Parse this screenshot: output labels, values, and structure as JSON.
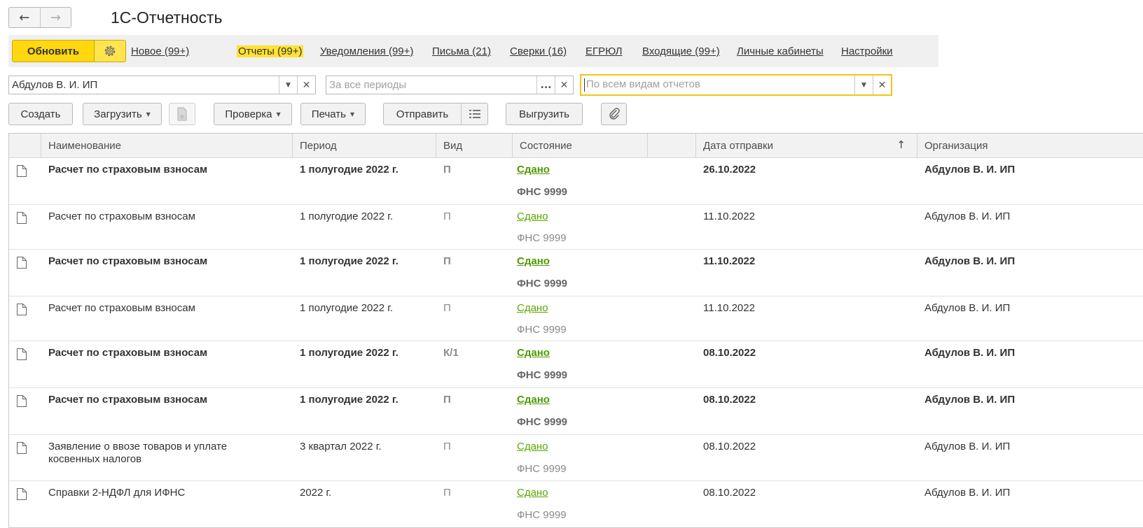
{
  "window": {
    "title": "1С-Отчетность",
    "back_icon": "arrow-left-icon",
    "forward_icon": "arrow-right-icon"
  },
  "linkbar": {
    "refresh_label": "Обновить",
    "settings_icon": "gear-icon",
    "links": [
      {
        "label": "Новое (99+)",
        "active": false
      },
      {
        "label": "Отчеты (99+)",
        "active": true
      },
      {
        "label": "Уведомления (99+)",
        "active": false
      },
      {
        "label": "Письма (21)",
        "active": false
      },
      {
        "label": "Сверки (16)",
        "active": false
      },
      {
        "label": "ЕГРЮЛ",
        "active": false
      },
      {
        "label": "Входящие (99+)",
        "active": false
      },
      {
        "label": "Личные кабинеты",
        "active": false
      },
      {
        "label": "Настройки",
        "active": false
      }
    ]
  },
  "filters": {
    "organization": {
      "value": "Абдулов В. И. ИП"
    },
    "period": {
      "placeholder": "За все периоды",
      "select_label": "..."
    },
    "report_kind": {
      "placeholder": "По всем видам отчетов"
    }
  },
  "toolbar": {
    "create": "Создать",
    "load": "Загрузить",
    "check": "Проверка",
    "print": "Печать",
    "send": "Отправить",
    "export": "Выгрузить"
  },
  "table": {
    "columns": [
      "Наименование",
      "Период",
      "Вид",
      "Состояние",
      "",
      "Дата отправки",
      "Организация"
    ],
    "sort_icon": "sort-ascending-icon",
    "rows": [
      {
        "bold": true,
        "name": "Расчет по страховым взносам",
        "period": "1 полугодие 2022 г.",
        "kind": "П",
        "status": "Сдано",
        "authority": "ФНС 9999",
        "date": "26.10.2022",
        "org": "Абдулов В. И. ИП"
      },
      {
        "bold": false,
        "name": "Расчет по страховым взносам",
        "period": "1 полугодие 2022 г.",
        "kind": "П",
        "status": "Сдано",
        "authority": "ФНС 9999",
        "date": "11.10.2022",
        "org": "Абдулов В. И. ИП"
      },
      {
        "bold": true,
        "name": "Расчет по страховым взносам",
        "period": "1 полугодие 2022 г.",
        "kind": "П",
        "status": "Сдано",
        "authority": "ФНС 9999",
        "date": "11.10.2022",
        "org": "Абдулов В. И. ИП"
      },
      {
        "bold": false,
        "name": "Расчет по страховым взносам",
        "period": "1 полугодие 2022 г.",
        "kind": "П",
        "status": "Сдано",
        "authority": "ФНС 9999",
        "date": "11.10.2022",
        "org": "Абдулов В. И. ИП"
      },
      {
        "bold": true,
        "name": "Расчет по страховым взносам",
        "period": "1 полугодие 2022 г.",
        "kind": "К/1",
        "status": "Сдано",
        "authority": "ФНС 9999",
        "date": "08.10.2022",
        "org": "Абдулов В. И. ИП"
      },
      {
        "bold": true,
        "name": "Расчет по страховым взносам",
        "period": "1 полугодие 2022 г.",
        "kind": "П",
        "status": "Сдано",
        "authority": "ФНС 9999",
        "date": "08.10.2022",
        "org": "Абдулов В. И. ИП"
      },
      {
        "bold": false,
        "name": "Заявление о ввозе товаров и уплате косвенных налогов",
        "period": "3 квартал 2022 г.",
        "kind": "П",
        "status": "Сдано",
        "authority": "ФНС 9999",
        "date": "08.10.2022",
        "org": "Абдулов В. И. ИП"
      },
      {
        "bold": false,
        "name": "Справки 2-НДФЛ для ИФНС",
        "period": "2022 г.",
        "kind": "П",
        "status": "Сдано",
        "authority": "ФНС 9999",
        "date": "08.10.2022",
        "org": "Абдулов В. И. ИП"
      }
    ]
  }
}
